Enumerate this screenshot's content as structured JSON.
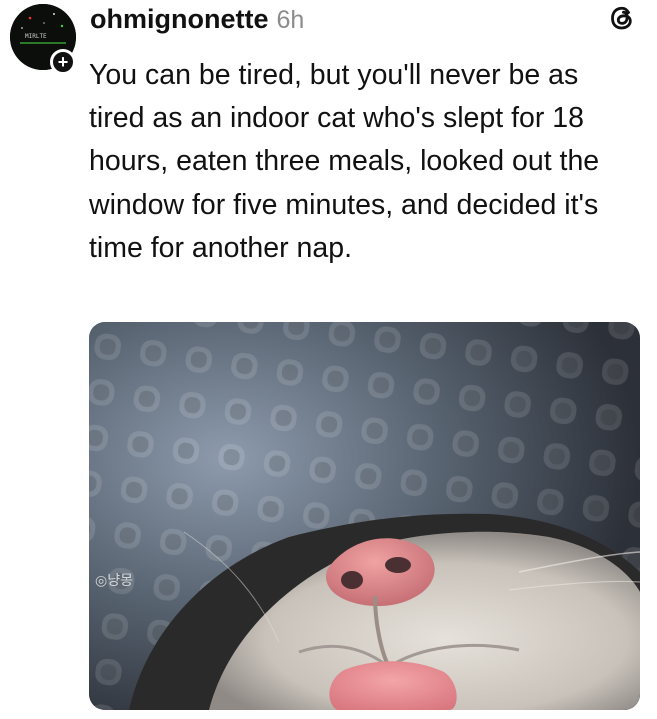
{
  "post": {
    "author": {
      "username": "ohmignonette",
      "avatar_text": "MIRLTE",
      "follow_symbol": "+"
    },
    "timestamp": "6h",
    "platform_icon": "threads-icon",
    "text": "You can be tired, but you'll never be as tired as an indoor cat who's slept for 18 hours, eaten three meals, looked out the window for five minutes, and decided it's time for another nap.",
    "media": {
      "watermark": "◎냥몽"
    }
  }
}
